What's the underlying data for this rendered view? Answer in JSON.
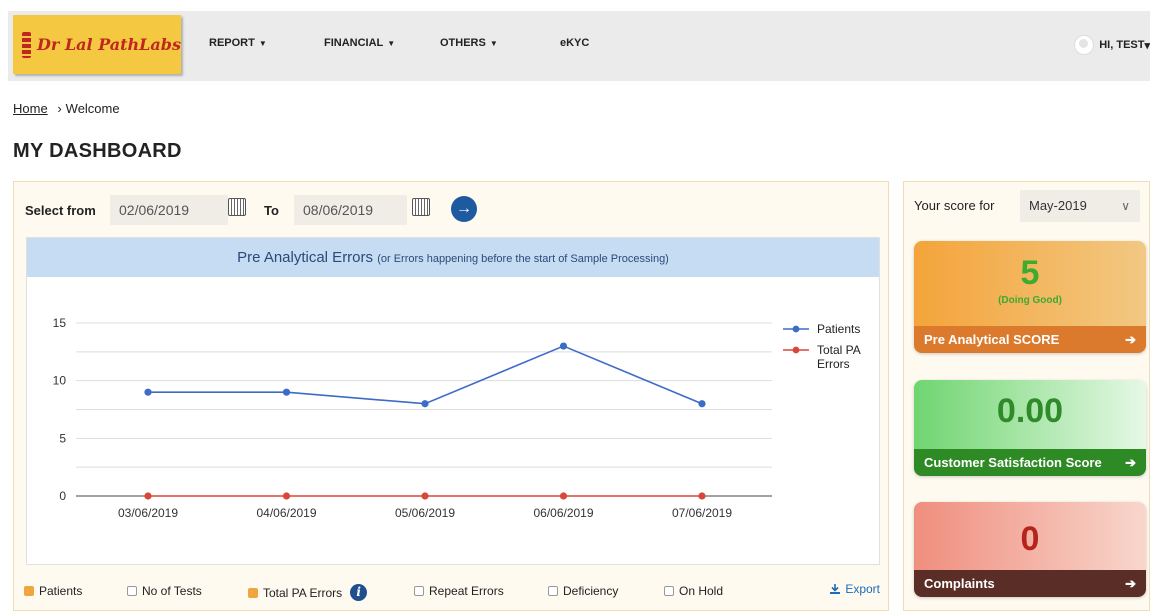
{
  "header": {
    "logo_text": "Dr Lal PathLabs",
    "nav": [
      {
        "label": "REPORT",
        "caret": "▼"
      },
      {
        "label": "FINANCIAL",
        "caret": "▼"
      },
      {
        "label": "OTHERS",
        "caret": "▼"
      },
      {
        "label": "eKYC",
        "caret": ""
      }
    ],
    "user_label": "HI, TEST",
    "user_caret": "▾"
  },
  "breadcrumb": {
    "home": "Home",
    "sep": "›",
    "current": "Welcome"
  },
  "page_title": "MY DASHBOARD",
  "filter": {
    "select_from_label": "Select from",
    "from_date": "02/06/2019",
    "to_label": "To",
    "to_date": "08/06/2019",
    "go_icon": "→"
  },
  "chart_header": {
    "main": "Pre Analytical Errors",
    "note": "(or Errors happening before the start of Sample Processing)"
  },
  "chart_data": {
    "type": "line",
    "x": [
      "03/06/2019",
      "04/06/2019",
      "05/06/2019",
      "06/06/2019",
      "07/06/2019"
    ],
    "series": [
      {
        "name": "Patients",
        "values": [
          9,
          9,
          8,
          13,
          8
        ],
        "color": "#3c6bc8"
      },
      {
        "name": "Total PA Errors",
        "values": [
          0,
          0,
          0,
          0,
          0
        ],
        "color": "#d9463a"
      }
    ],
    "ylim": [
      0,
      15
    ],
    "yticks": [
      0,
      5,
      10,
      15
    ],
    "grid": true,
    "legend": "right"
  },
  "checkboxes": [
    {
      "label": "Patients",
      "checked": true
    },
    {
      "label": "No of Tests",
      "checked": false
    },
    {
      "label": "Total PA Errors",
      "checked": true
    },
    {
      "label": "Repeat Errors",
      "checked": false
    },
    {
      "label": "Deficiency",
      "checked": false
    },
    {
      "label": "On Hold",
      "checked": false
    }
  ],
  "info_icon": "i",
  "export_label": "Export",
  "score": {
    "label": "Your score for",
    "month": "May-2019",
    "chevron": "∨",
    "cards": [
      {
        "value": "5",
        "sub": "(Doing Good)",
        "footer": "Pre Analytical SCORE",
        "arrow": "➔"
      },
      {
        "value": "0.00",
        "footer": "Customer Satisfaction Score",
        "arrow": "➔"
      },
      {
        "value": "0",
        "footer": "Complaints",
        "arrow": "➔"
      }
    ]
  }
}
